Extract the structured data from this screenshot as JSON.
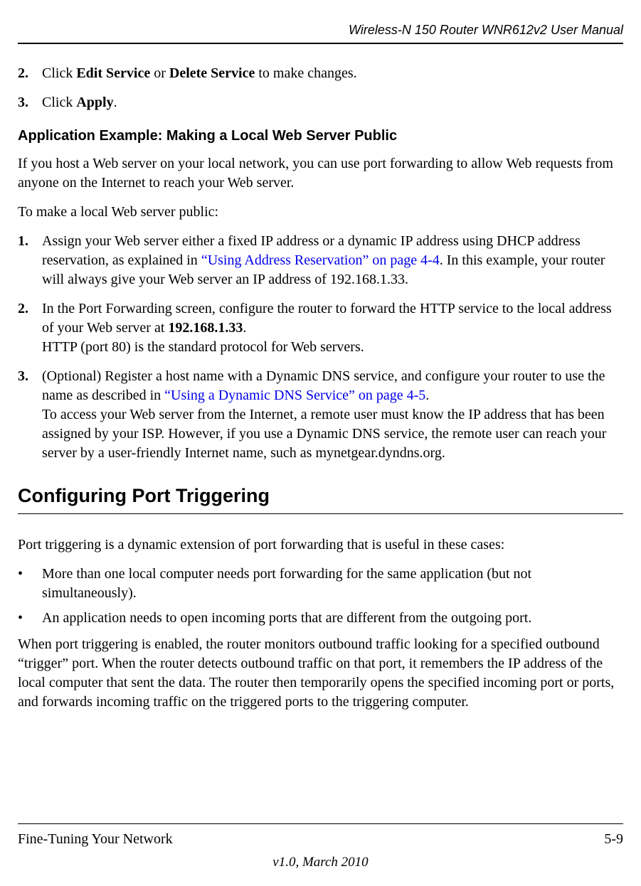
{
  "header": {
    "title": "Wireless-N 150 Router WNR612v2 User Manual"
  },
  "topList": {
    "items": [
      {
        "num": "2.",
        "prefix": "Click ",
        "bold1": "Edit Service",
        "mid": " or ",
        "bold2": "Delete Service",
        "suffix": " to make changes."
      },
      {
        "num": "3.",
        "prefix": "Click ",
        "bold1": "Apply",
        "suffix": "."
      }
    ]
  },
  "subheading1": "Application Example: Making a Local Web Server Public",
  "para1": "If you host a Web server on your local network, you can use port forwarding to allow Web requests from anyone on the Internet to reach your Web server.",
  "para2": "To make a local Web server public:",
  "webList": {
    "item1": {
      "num": "1.",
      "text1": "Assign your Web server either a fixed IP address or a dynamic IP address using DHCP address reservation, as explained in ",
      "link": "“Using Address Reservation” on page 4-4",
      "text2": ". In this example, your router will always give your Web server an IP address of 192.168.1.33."
    },
    "item2": {
      "num": "2.",
      "text1": "In the Port Forwarding screen, configure the router to forward the HTTP service to the local address of your Web server at ",
      "bold": "192.168.1.33",
      "text2": ".",
      "line2": "HTTP (port 80) is the standard protocol for Web servers."
    },
    "item3": {
      "num": "3.",
      "text1": "(Optional) Register a host name with a Dynamic DNS service, and configure your router to use the name as described in ",
      "link": "“Using a Dynamic DNS Service” on page 4-5",
      "text2": ".",
      "line2": "To access your Web server from the Internet, a remote user must know the IP address that has been assigned by your ISP. However, if you use a Dynamic DNS service, the remote user can reach your server by a user-friendly Internet name, such as mynetgear.dyndns.org."
    }
  },
  "sectionHeading": "Configuring Port Triggering",
  "para3": "Port triggering is a dynamic extension of port forwarding that is useful in these cases:",
  "bulletList": {
    "items": [
      "More than one local computer needs port forwarding for the same application (but not simultaneously).",
      "An application needs to open incoming ports that are different from the outgoing port."
    ]
  },
  "para4": "When port triggering is enabled, the router monitors outbound traffic looking for a specified outbound “trigger” port. When the router detects outbound traffic on that port, it remembers the IP address of the local computer that sent the data. The router then temporarily opens the specified incoming port or ports, and forwards incoming traffic on the triggered ports to the triggering computer.",
  "footer": {
    "chapter": "Fine-Tuning Your Network",
    "page": "5-9",
    "version": "v1.0, March 2010"
  }
}
